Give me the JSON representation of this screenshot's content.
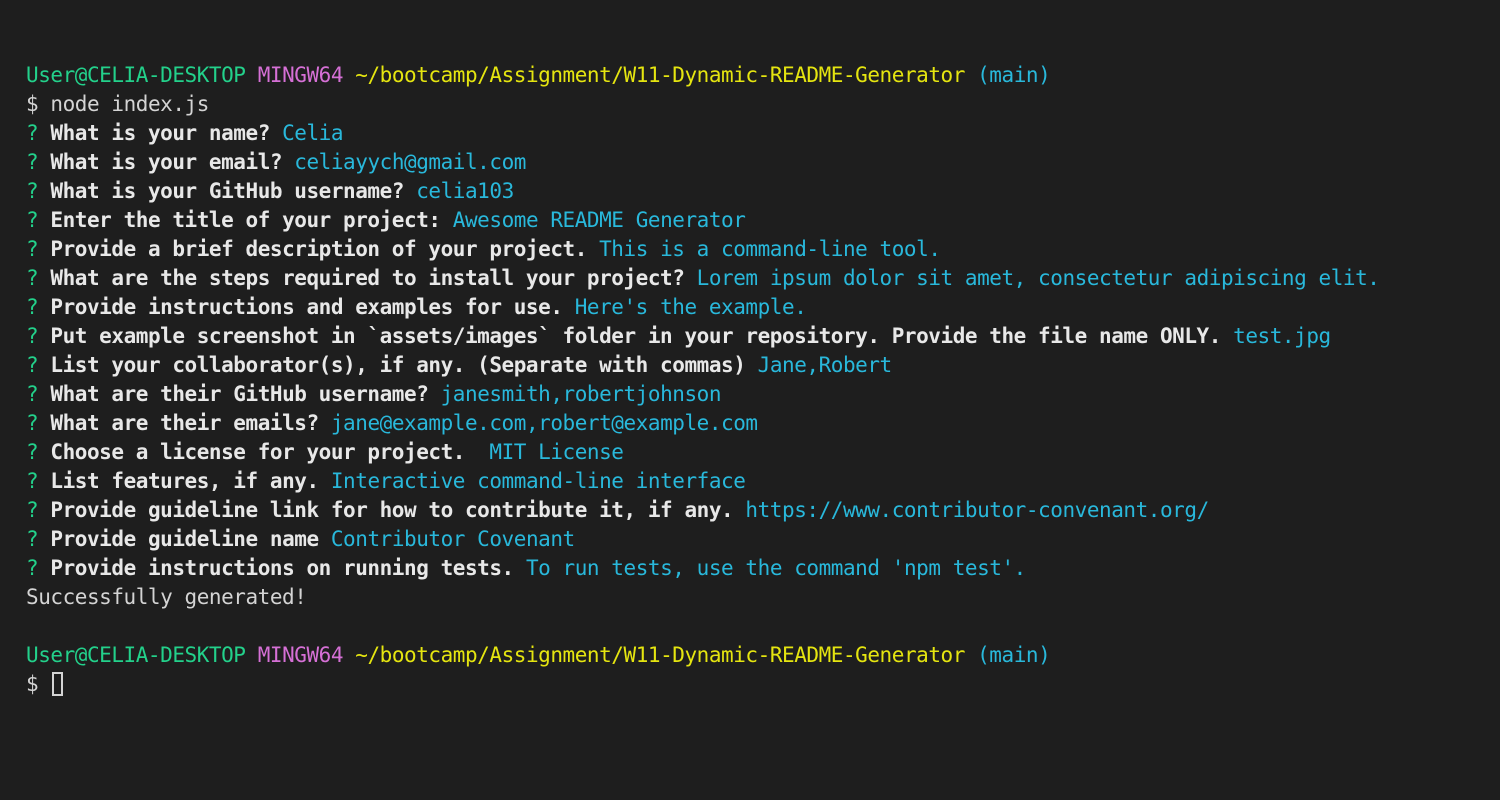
{
  "prompt": {
    "user": "User@CELIA-DESKTOP",
    "system": "MINGW64",
    "path": "~/bootcamp/Assignment/W11-Dynamic-README-Generator",
    "branch": "(main)",
    "symbol": "$"
  },
  "command": "node index.js",
  "question_marker": "?",
  "qa": [
    {
      "q": "What is your name?",
      "a": "Celia"
    },
    {
      "q": "What is your email?",
      "a": "celiayych@gmail.com"
    },
    {
      "q": "What is your GitHub username?",
      "a": "celia103"
    },
    {
      "q": "Enter the title of your project:",
      "a": "Awesome README Generator"
    },
    {
      "q": "Provide a brief description of your project.",
      "a": "This is a command-line tool."
    },
    {
      "q": "What are the steps required to install your project?",
      "a": "Lorem ipsum dolor sit amet, consectetur adipiscing elit."
    },
    {
      "q": "Provide instructions and examples for use.",
      "a": "Here's the example."
    },
    {
      "q": "Put example screenshot in `assets/images` folder in your repository. Provide the file name ONLY.",
      "a": "test.jpg"
    },
    {
      "q": "List your collaborator(s), if any. (Separate with commas)",
      "a": "Jane,Robert"
    },
    {
      "q": "What are their GitHub username?",
      "a": "janesmith,robertjohnson"
    },
    {
      "q": "What are their emails?",
      "a": "jane@example.com,robert@example.com"
    },
    {
      "q": "Choose a license for your project. ",
      "a": "MIT License"
    },
    {
      "q": "List features, if any.",
      "a": "Interactive command-line interface"
    },
    {
      "q": "Provide guideline link for how to contribute it, if any.",
      "a": "https://www.contributor-convenant.org/"
    },
    {
      "q": "Provide guideline name",
      "a": "Contributor Covenant"
    },
    {
      "q": "Provide instructions on running tests.",
      "a": "To run tests, use the command 'npm test'."
    }
  ],
  "result": "Successfully generated!"
}
